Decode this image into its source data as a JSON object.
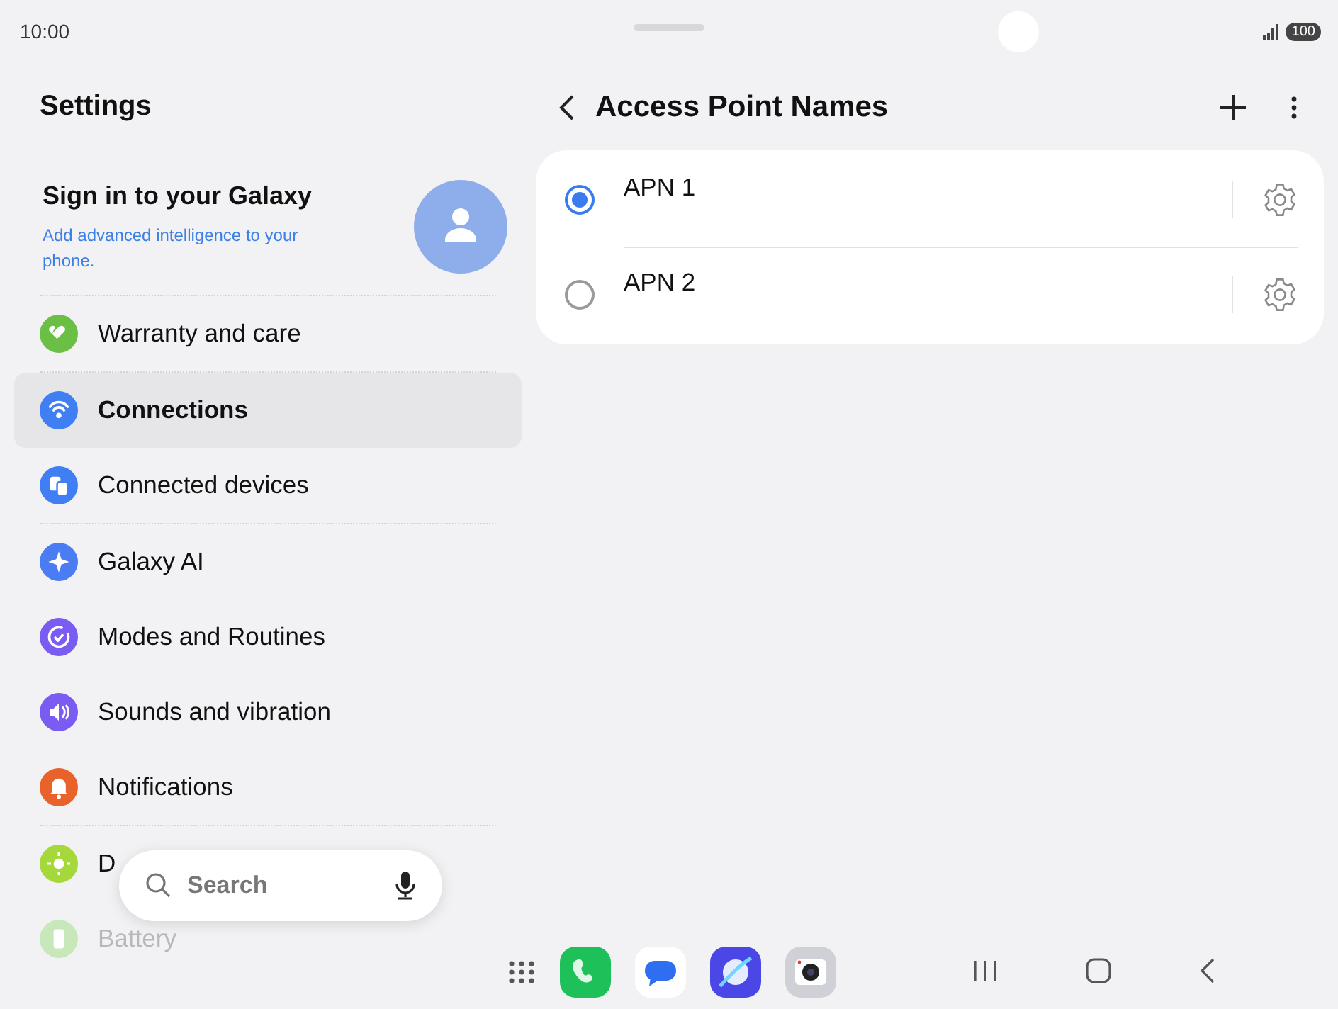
{
  "status_bar": {
    "time": "10:00",
    "battery": "100"
  },
  "sidebar": {
    "title": "Settings",
    "account": {
      "title": "Sign in to your Galaxy",
      "subtitle": "Add advanced intelligence to your phone."
    },
    "groups": [
      [
        {
          "label": "Warranty and care",
          "kind": "heart",
          "color": "#6cbf45",
          "selected": false,
          "faded": false
        }
      ],
      [
        {
          "label": "Connections",
          "kind": "wifi",
          "color": "#3f7ff3",
          "selected": true,
          "faded": false
        },
        {
          "label": "Connected devices",
          "kind": "devices",
          "color": "#3f7ff3",
          "selected": false,
          "faded": false
        }
      ],
      [
        {
          "label": "Galaxy AI",
          "kind": "sparkle",
          "color": "#4a7cf4",
          "selected": false,
          "faded": false
        },
        {
          "label": "Modes and Routines",
          "kind": "check",
          "color": "#7a5cf2",
          "selected": false,
          "faded": false
        },
        {
          "label": "Sounds and vibration",
          "kind": "speaker",
          "color": "#7a5cf2",
          "selected": false,
          "faded": false
        },
        {
          "label": "Notifications",
          "kind": "bell",
          "color": "#e9622a",
          "selected": false,
          "faded": false
        }
      ],
      [
        {
          "label": "D",
          "kind": "sun",
          "color": "#a5d83a",
          "selected": false,
          "faded": false
        },
        {
          "label": "Battery",
          "kind": "battery",
          "color": "#c8e8bc",
          "selected": false,
          "faded": true
        }
      ]
    ]
  },
  "search": {
    "placeholder": "Search"
  },
  "detail": {
    "title": "Access Point Names",
    "apns": [
      {
        "name": "APN 1",
        "selected": true
      },
      {
        "name": "APN 2",
        "selected": false
      }
    ]
  },
  "dock": {
    "apps": [
      {
        "kind": "phone"
      },
      {
        "kind": "messages"
      },
      {
        "kind": "browser"
      },
      {
        "kind": "camera"
      }
    ]
  }
}
